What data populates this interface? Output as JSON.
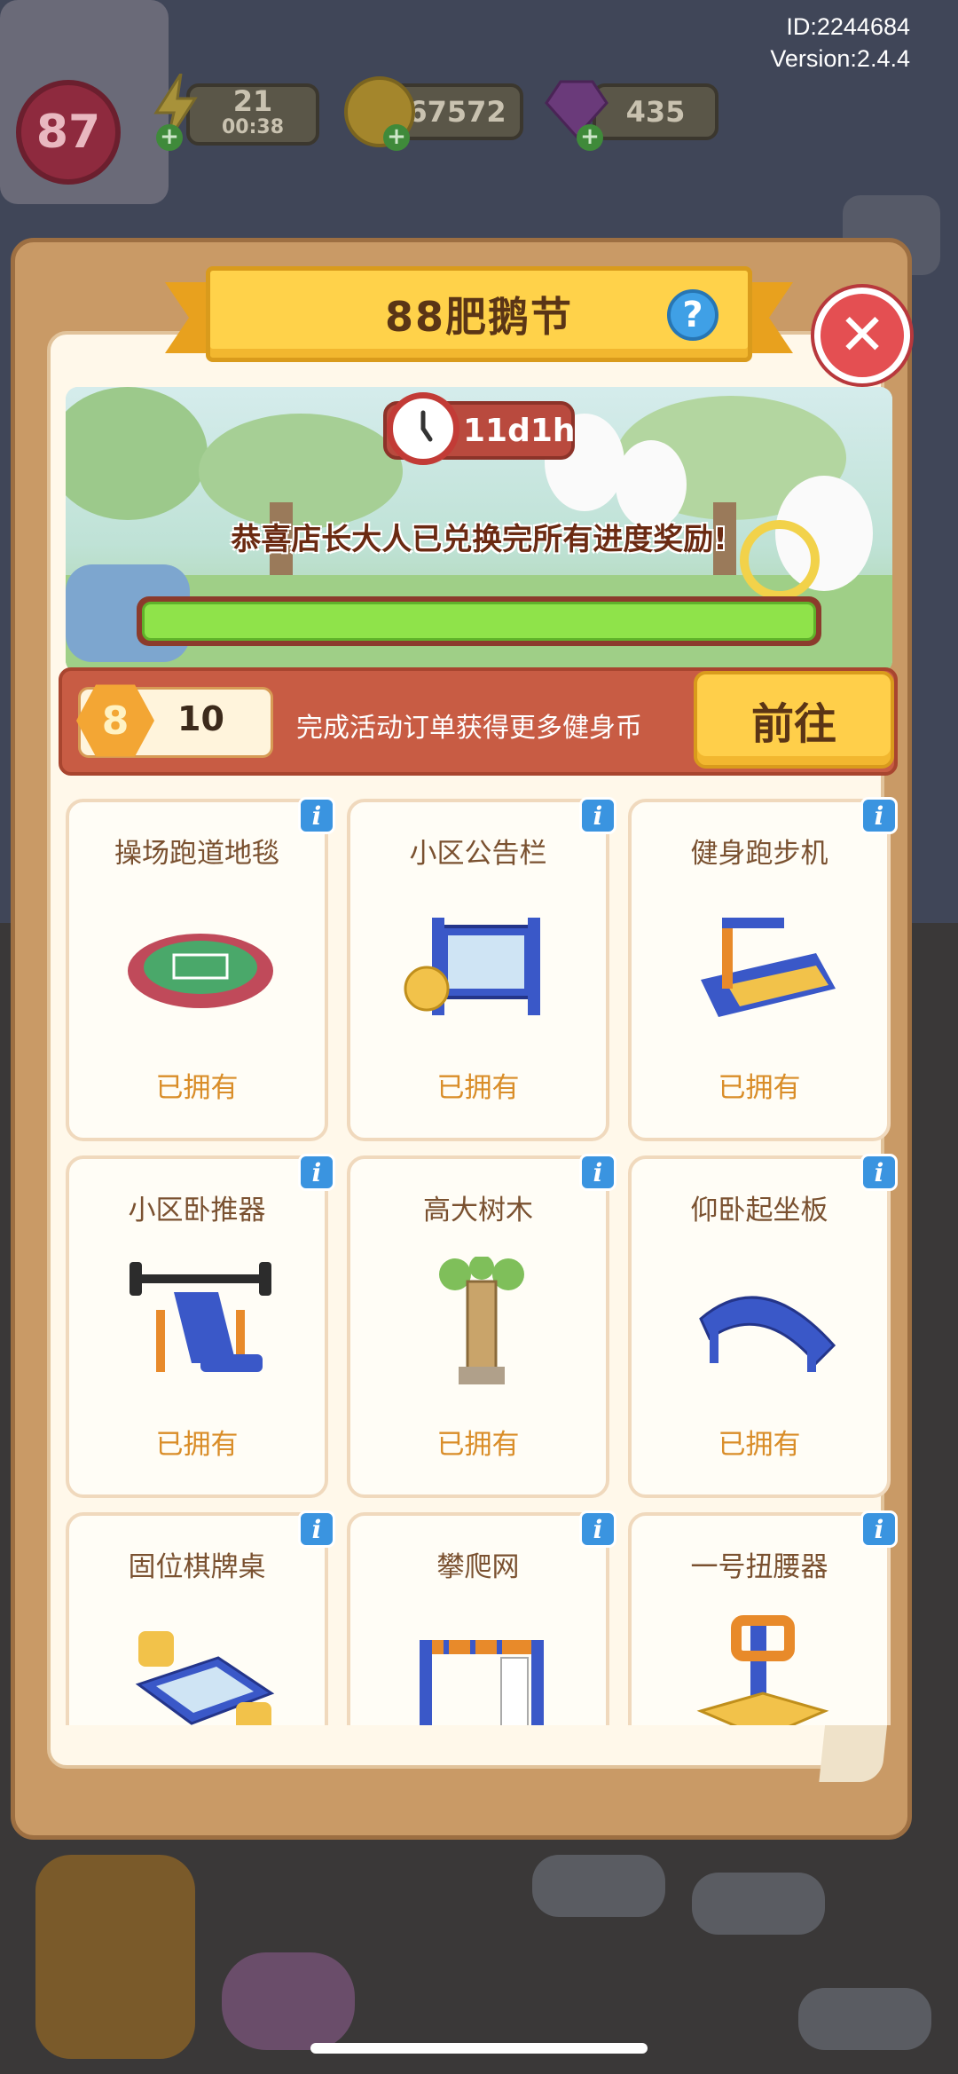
{
  "hud": {
    "player_id": "ID:2244684",
    "version": "Version:2.4.4",
    "level": "87",
    "energy": "21",
    "energy_timer": "00:38",
    "coins": "67572",
    "gems": "435"
  },
  "event": {
    "title": "88肥鹅节",
    "timer": "11d1h",
    "message": "恭喜店长大人已兑换完所有进度奖励!",
    "progress": 1.0
  },
  "orders": {
    "coin_icon_label": "8",
    "coin_count": "10",
    "description": "完成活动订单获得更多健身币",
    "go_label": "前往"
  },
  "items": [
    {
      "name": "操场跑道地毯",
      "status": "已拥有",
      "icon": "running-track-icon"
    },
    {
      "name": "小区公告栏",
      "status": "已拥有",
      "icon": "bulletin-board-icon"
    },
    {
      "name": "健身跑步机",
      "status": "已拥有",
      "icon": "treadmill-icon"
    },
    {
      "name": "小区卧推器",
      "status": "已拥有",
      "icon": "bench-press-icon"
    },
    {
      "name": "高大树木",
      "status": "已拥有",
      "icon": "tall-tree-icon"
    },
    {
      "name": "仰卧起坐板",
      "status": "已拥有",
      "icon": "situp-board-icon"
    },
    {
      "name": "固位棋牌桌",
      "status": "",
      "icon": "chess-table-icon"
    },
    {
      "name": "攀爬网",
      "status": "",
      "icon": "climbing-net-icon"
    },
    {
      "name": "一号扭腰器",
      "status": "",
      "icon": "waist-twister-icon"
    }
  ],
  "colors": {
    "panel": "#c99a66",
    "ribbon": "#ffd24a",
    "close": "#e44f52",
    "progress": "#8fe34a",
    "owned_text": "#d98d28",
    "info": "#3a94e0"
  }
}
